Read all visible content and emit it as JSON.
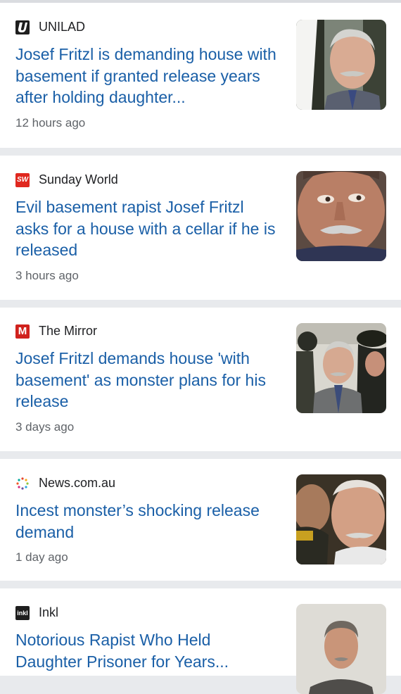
{
  "articles": [
    {
      "source": "UNILAD",
      "headline": "Josef Fritzl is demanding house with basement if granted release years after holding daughter...",
      "time": "12 hours ago",
      "logo_icon": "unilad-logo-icon",
      "thumb_icon": "fritzl-photo-icon"
    },
    {
      "source": "Sunday World",
      "headline": "Evil basement rapist Josef Fritzl asks for a house with a cellar if he is released",
      "time": "3 hours ago",
      "logo_icon": "sunday-world-logo-icon",
      "logo_text": "SW",
      "thumb_icon": "fritzl-closeup-photo-icon"
    },
    {
      "source": "The Mirror",
      "headline": "Josef Fritzl demands house 'with basement' as monster plans for his release",
      "time": "3 days ago",
      "logo_icon": "mirror-logo-icon",
      "logo_text": "M",
      "thumb_icon": "fritzl-court-photo-icon"
    },
    {
      "source": "News.com.au",
      "headline": "Incest monster’s shocking release demand",
      "time": "1 day ago",
      "logo_icon": "news-com-au-logo-icon",
      "thumb_icon": "fritzl-escort-photo-icon"
    },
    {
      "source": "Inkl",
      "headline": "Notorious Rapist Who Held Daughter Prisoner for Years...",
      "time": "",
      "logo_icon": "inkl-logo-icon",
      "logo_text": "inkl",
      "thumb_icon": "fritzl-mugshot-photo-icon"
    }
  ],
  "colors": {
    "headline": "#1a5fa7",
    "source": "#202124",
    "time": "#5f6368",
    "divider": "#e8eaed",
    "sunday_world": "#e0281f",
    "mirror": "#d0211d"
  }
}
